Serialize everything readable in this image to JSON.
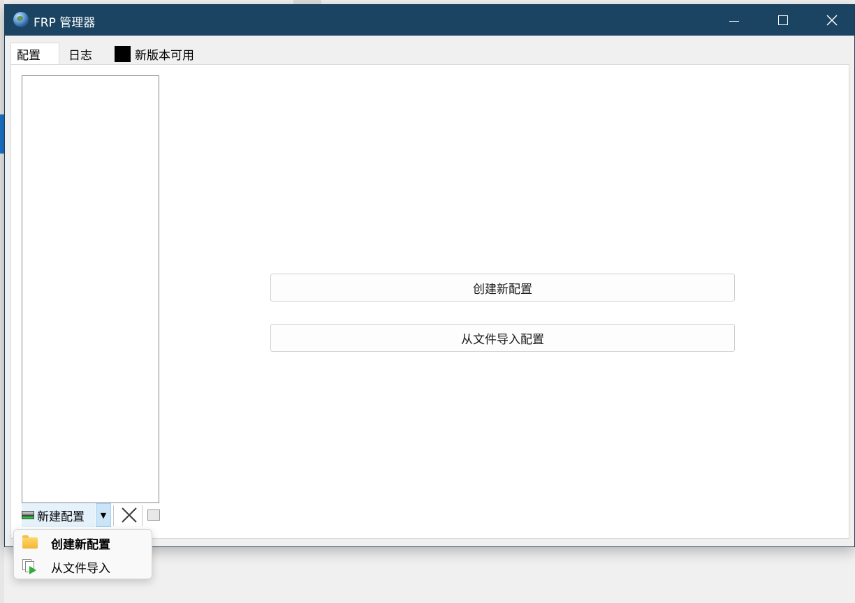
{
  "window": {
    "title": "FRP 管理器"
  },
  "tabs": [
    {
      "label": "配置",
      "active": true
    },
    {
      "label": "日志",
      "active": false
    },
    {
      "label": "新版本可用",
      "active": false
    }
  ],
  "main": {
    "create_button": "创建新配置",
    "import_button": "从文件导入配置"
  },
  "toolbar": {
    "new_label": "新建配置",
    "dropdown_arrow": "▼"
  },
  "menu": {
    "items": [
      {
        "label": "创建新配置",
        "icon": "folder-icon"
      },
      {
        "label": "从文件导入",
        "icon": "import-file-icon"
      }
    ]
  },
  "colors": {
    "titlebar": "#1b4462",
    "accent": "#cce4f7"
  }
}
